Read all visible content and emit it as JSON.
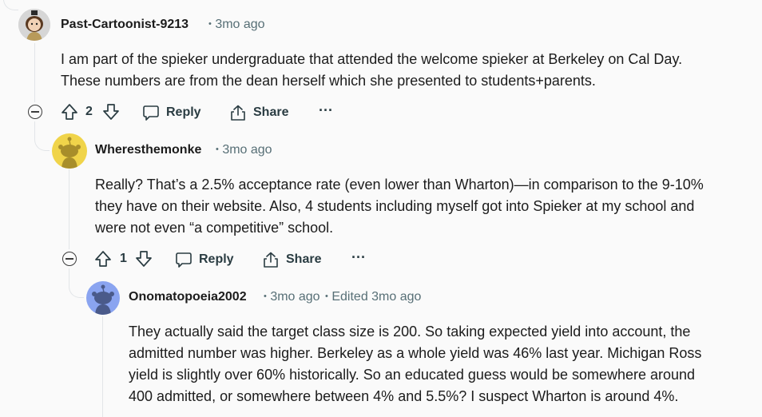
{
  "comments": [
    {
      "username": "Past-Cartoonist-9213",
      "time": "3mo ago",
      "body_lines": [
        "I am part of the spieker undergraduate that attended the welcome spieker at Berkeley on Cal Day.",
        "These numbers are from the dean herself which she presented to students+parents."
      ],
      "votes": "2",
      "reply_label": "Reply",
      "share_label": "Share",
      "more_label": "···"
    },
    {
      "username": "Wheresthemonke",
      "time": "3mo ago",
      "body_lines": [
        "Really? That’s a 2.5% acceptance rate (even lower than Wharton)—in comparison to the 9-10%",
        "they have on their website. Also, 4 students including myself got into Spieker at my school and",
        "were not even “a competitive” school."
      ],
      "votes": "1",
      "reply_label": "Reply",
      "share_label": "Share",
      "more_label": "···"
    },
    {
      "username": "Onomatopoeia2002",
      "time": "3mo ago",
      "edited": "Edited 3mo ago",
      "body_lines": [
        "They actually said the target class size is 200. So taking expected yield into account, the",
        "admitted number was higher. Berkeley as a whole yield was 46% last year. Michigan Ross",
        "yield is slightly over 60% historically. So an educated guess would be somewhere around",
        "400 admitted, or somewhere between 4% and 5.5%? I suspect Wharton is around 4%."
      ]
    }
  ],
  "separator": "•",
  "colors": {
    "avatar1_bg": "#d8d8d8",
    "avatar2_bg": "#f0d44a",
    "avatar3_bg": "#8aa4f0",
    "thread_line": "#e2e5e8"
  }
}
